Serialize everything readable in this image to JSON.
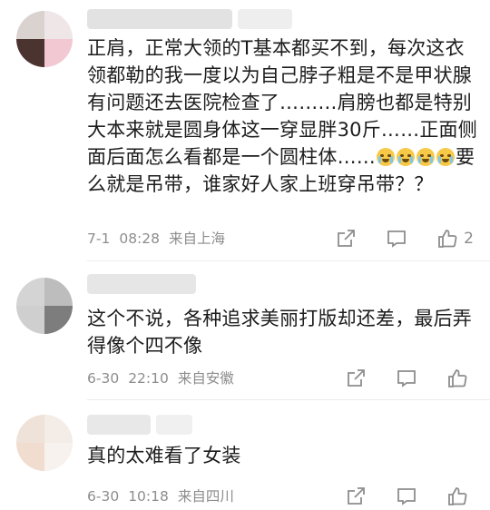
{
  "comments": [
    {
      "text_before_emoji": "正肩，正常大领的T基本都买不到，每次这衣领都勒的我一度以为自己脖子粗是不是甲状腺有问题还去医院检查了………肩膀也都是特别大本来就是圆身体这一穿显胖30斤……正面侧面后面怎么看都是一个圆柱体……",
      "emoji_name": "crying-face-emoji",
      "text_after_emoji": "要么就是吊带，谁家好人家上班穿吊带？？",
      "date": "7-1",
      "time": "08:28",
      "location": "来自上海",
      "likes": "2"
    },
    {
      "text": "这个不说，各种追求美丽打版却还差，最后弄得像个四不像",
      "date": "6-30",
      "time": "22:10",
      "location": "来自安徽",
      "likes": ""
    },
    {
      "text": "真的太难看了女装",
      "date": "6-30",
      "time": "10:18",
      "location": "来自四川",
      "likes": ""
    }
  ],
  "icons": {
    "share": "share-icon",
    "comment": "comment-icon",
    "like": "thumbs-up-icon"
  },
  "colors": {
    "text": "#1c1c1c",
    "meta": "#8d8d8d",
    "divider": "#ececec"
  }
}
